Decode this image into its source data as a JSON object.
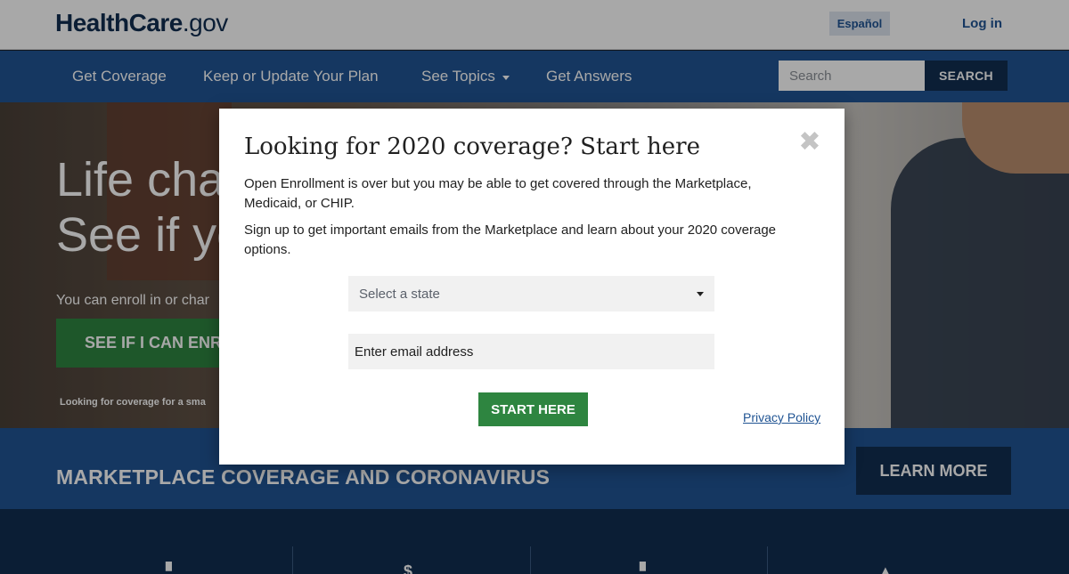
{
  "header": {
    "logo_bold": "HealthCare",
    "logo_light": ".gov",
    "language_button": "Español",
    "login_link": "Log in"
  },
  "nav": {
    "items": [
      {
        "label": "Get Coverage",
        "has_dropdown": false
      },
      {
        "label": "Keep or Update Your Plan",
        "has_dropdown": false
      },
      {
        "label": "See Topics",
        "has_dropdown": true
      },
      {
        "label": "Get Answers",
        "has_dropdown": false
      }
    ],
    "search_placeholder": "Search",
    "search_button": "SEARCH"
  },
  "hero": {
    "title_line1": "Life cha",
    "title_line2": "See if yo",
    "subtitle": "You can enroll in or char",
    "cta": "SEE IF I CAN ENRO",
    "small_text": "Looking for coverage for a sma"
  },
  "banner": {
    "text": "MARKETPLACE COVERAGE AND CORONAVIRUS",
    "button": "LEARN MORE"
  },
  "bottom": {
    "icons": [
      "document-icon",
      "dollar-icon",
      "document-icon",
      "road-icon"
    ]
  },
  "modal": {
    "title": "Looking for 2020 coverage? Start here",
    "paragraph1": "Open Enrollment is over but you may be able to get covered through the Marketplace, Medicaid, or CHIP.",
    "paragraph2": "Sign up to get important emails from the Marketplace and learn about your 2020 coverage options.",
    "state_select": "Select a state",
    "email_placeholder": "Enter email address",
    "submit_button": "START HERE",
    "privacy_link": "Privacy Policy",
    "close_symbol": "✖"
  },
  "colors": {
    "primary_blue": "#205493",
    "dark_blue": "#112e51",
    "green": "#2e8540"
  }
}
